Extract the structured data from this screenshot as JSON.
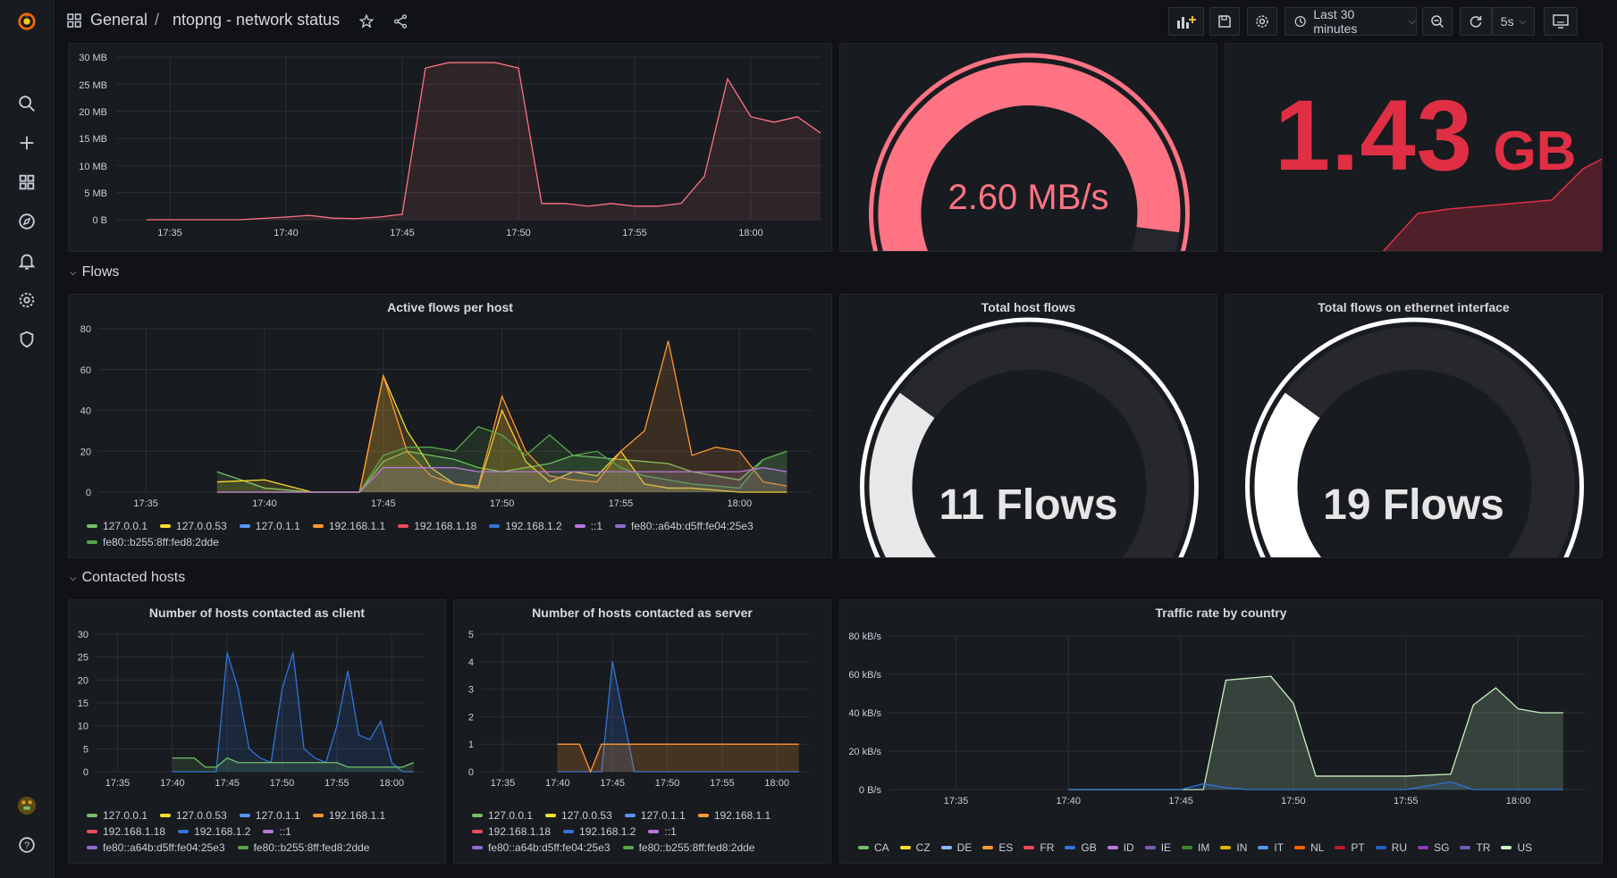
{
  "topbar": {
    "breadcrumb_folder": "General",
    "breadcrumb_sep": "/",
    "dashboard_title": "ntopng - network status",
    "time_range": "Last 30 minutes",
    "refresh_interval": "5s"
  },
  "sidebar": {
    "icons": [
      "grafana-logo-icon",
      "search-icon",
      "plus-icon",
      "dashboards-icon",
      "explore-icon",
      "alerting-icon",
      "settings-icon",
      "shield-icon",
      "user-avatar",
      "help-icon"
    ]
  },
  "panels": {
    "traffic_graph": {
      "y_ticks": [
        "30 MB",
        "25 MB",
        "20 MB",
        "15 MB",
        "10 MB",
        "5 MB",
        "0 B"
      ],
      "x_ticks": [
        "17:35",
        "17:40",
        "17:45",
        "17:50",
        "17:55",
        "18:00"
      ]
    },
    "traffic_gauge": {
      "value": "2.60 MB/s",
      "fraction": 0.86,
      "color": "#ff7383"
    },
    "total_traffic": {
      "value": "1.43",
      "unit": "GB",
      "color": "#e02f44"
    },
    "total_host_flows": {
      "title": "Total host flows",
      "value": "11 Flows",
      "fraction": 0.3
    },
    "total_eth_flows": {
      "title": "Total flows on ethernet interface",
      "value": "19 Flows",
      "fraction": 0.3
    }
  },
  "rows": {
    "flows": "Flows",
    "contacted": "Contacted hosts"
  },
  "legends": {
    "hosts": [
      {
        "name": "127.0.0.1",
        "color": "#73bf69"
      },
      {
        "name": "127.0.0.53",
        "color": "#fade2a"
      },
      {
        "name": "127.0.1.1",
        "color": "#5794f2"
      },
      {
        "name": "192.168.1.1",
        "color": "#ff9830"
      },
      {
        "name": "192.168.1.18",
        "color": "#f2495c"
      },
      {
        "name": "192.168.1.2",
        "color": "#3274d9"
      },
      {
        "name": "::1",
        "color": "#b877d9"
      },
      {
        "name": "fe80::a64b:d5ff:fe04:25e3",
        "color": "#8f6bd1"
      },
      {
        "name": "fe80::b255:8ff:fed8:2dde",
        "color": "#56a64b"
      }
    ],
    "countries": [
      {
        "name": "CA",
        "color": "#73bf69"
      },
      {
        "name": "CZ",
        "color": "#fade2a"
      },
      {
        "name": "DE",
        "color": "#8ab8ff"
      },
      {
        "name": "ES",
        "color": "#ff9830"
      },
      {
        "name": "FR",
        "color": "#f2495c"
      },
      {
        "name": "GB",
        "color": "#3274d9"
      },
      {
        "name": "ID",
        "color": "#b877d9"
      },
      {
        "name": "IE",
        "color": "#7d5cb0"
      },
      {
        "name": "IM",
        "color": "#37872d"
      },
      {
        "name": "IN",
        "color": "#e0b400"
      },
      {
        "name": "IT",
        "color": "#5794f2"
      },
      {
        "name": "NL",
        "color": "#fa6400"
      },
      {
        "name": "PT",
        "color": "#c4162a"
      },
      {
        "name": "RU",
        "color": "#1f60c4"
      },
      {
        "name": "SG",
        "color": "#8f3bb8"
      },
      {
        "name": "TR",
        "color": "#6f5bb0"
      },
      {
        "name": "US",
        "color": "#c8f2c2"
      }
    ]
  },
  "chart_data": [
    {
      "type": "area",
      "title": "",
      "x": [
        "17:34",
        "17:36",
        "17:38",
        "17:40",
        "17:41",
        "17:42",
        "17:43",
        "17:44",
        "17:45",
        "17:46",
        "17:47",
        "17:48",
        "17:49",
        "17:50",
        "17:51",
        "17:52",
        "17:53",
        "17:54",
        "17:55",
        "17:56",
        "17:57",
        "17:58",
        "17:59",
        "18:00",
        "18:01",
        "18:02",
        "18:03"
      ],
      "series": [
        {
          "values": [
            0,
            0,
            0,
            0.5,
            0.8,
            0.3,
            0.2,
            0.5,
            1,
            28,
            29,
            29,
            29,
            28,
            3,
            3,
            2.5,
            3,
            2.5,
            2.5,
            3,
            8,
            26,
            19,
            18,
            19,
            16
          ]
        }
      ],
      "ylim": [
        0,
        30
      ],
      "y_unit": "MB"
    },
    {
      "type": "line",
      "title": "Active flows per host",
      "x": [
        "17:38",
        "17:40",
        "17:42",
        "17:44",
        "17:45",
        "17:46",
        "17:47",
        "17:48",
        "17:49",
        "17:50",
        "17:51",
        "17:52",
        "17:53",
        "17:54",
        "17:55",
        "17:56",
        "17:57",
        "17:58",
        "17:59",
        "18:00",
        "18:01",
        "18:02"
      ],
      "series": [
        {
          "name": "127.0.0.1",
          "values": [
            10,
            2,
            0,
            0,
            15,
            20,
            18,
            16,
            12,
            10,
            12,
            14,
            18,
            17,
            16,
            15,
            14,
            10,
            8,
            6,
            16,
            20
          ]
        },
        {
          "name": "127.0.0.53",
          "values": [
            5,
            6,
            0,
            0,
            57,
            30,
            12,
            4,
            2,
            40,
            15,
            5,
            10,
            8,
            20,
            4,
            2,
            2,
            1,
            0,
            0,
            0
          ]
        },
        {
          "name": "192.168.1.1",
          "values": [
            0,
            0,
            0,
            0,
            57,
            20,
            8,
            4,
            3,
            47,
            20,
            8,
            6,
            5,
            20,
            30,
            74,
            18,
            22,
            20,
            5,
            3
          ]
        },
        {
          "name": "fe80::b255:8ff:fed8:2dde",
          "values": [
            0,
            0,
            0,
            0,
            18,
            22,
            22,
            20,
            32,
            28,
            18,
            28,
            18,
            20,
            12,
            8,
            6,
            4,
            3,
            2,
            16,
            20
          ]
        },
        {
          "name": "::1",
          "values": [
            0,
            0,
            0,
            0,
            12,
            12,
            12,
            12,
            10,
            10,
            10,
            10,
            10,
            10,
            10,
            10,
            10,
            10,
            10,
            10,
            12,
            10
          ]
        }
      ],
      "ylim": [
        0,
        80
      ]
    },
    {
      "type": "line",
      "title": "Number of hosts contacted as client",
      "x": [
        "17:40",
        "17:42",
        "17:43",
        "17:44",
        "17:45",
        "17:46",
        "17:47",
        "17:48",
        "17:49",
        "17:50",
        "17:51",
        "17:52",
        "17:53",
        "17:54",
        "17:55",
        "17:56",
        "17:57",
        "17:58",
        "17:59",
        "18:00",
        "18:01",
        "18:02"
      ],
      "series": [
        {
          "name": "192.168.1.2",
          "values": [
            0,
            0,
            0,
            0,
            26,
            18,
            5,
            3,
            2,
            18,
            26,
            5,
            3,
            2,
            10,
            22,
            8,
            7,
            11,
            2,
            0,
            0
          ]
        },
        {
          "name": "127.0.0.1",
          "values": [
            3,
            3,
            1,
            1,
            3,
            2,
            2,
            2,
            2,
            2,
            2,
            2,
            2,
            2,
            2,
            1,
            1,
            1,
            1,
            1,
            1,
            2
          ]
        }
      ],
      "ylim": [
        0,
        30
      ]
    },
    {
      "type": "line",
      "title": "Number of hosts contacted as server",
      "x": [
        "17:40",
        "17:41",
        "17:42",
        "17:43",
        "17:44",
        "17:45",
        "17:46",
        "17:47",
        "17:48",
        "17:49",
        "17:50",
        "17:51",
        "17:52",
        "17:53",
        "17:54",
        "17:55",
        "17:56",
        "17:57",
        "17:58",
        "17:59",
        "18:00",
        "18:01",
        "18:02"
      ],
      "series": [
        {
          "name": "192.168.1.2",
          "values": [
            0,
            0,
            0,
            0,
            0,
            4,
            2,
            0,
            0,
            0,
            0,
            0,
            0,
            0,
            0,
            0,
            0,
            0,
            0,
            0,
            0,
            0,
            0
          ]
        },
        {
          "name": "192.168.1.1",
          "values": [
            1,
            1,
            1,
            0,
            1,
            1,
            1,
            1,
            1,
            1,
            1,
            1,
            1,
            1,
            1,
            1,
            1,
            1,
            1,
            1,
            1,
            1,
            1
          ]
        }
      ],
      "ylim": [
        0,
        5
      ]
    },
    {
      "type": "line",
      "title": "Traffic rate by country",
      "x": [
        "17:40",
        "17:43",
        "17:45",
        "17:46",
        "17:47",
        "17:48",
        "17:49",
        "17:50",
        "17:51",
        "17:53",
        "17:55",
        "17:57",
        "17:58",
        "17:59",
        "18:00",
        "18:01",
        "18:02"
      ],
      "series": [
        {
          "name": "US",
          "values": [
            0,
            0,
            0,
            0,
            57,
            58,
            59,
            45,
            7,
            7,
            7,
            8,
            44,
            53,
            42,
            40,
            40
          ]
        },
        {
          "name": "GB",
          "values": [
            0,
            0,
            0,
            3,
            1,
            0,
            0,
            0,
            0,
            0,
            0,
            4,
            0,
            0,
            0,
            0,
            0
          ]
        }
      ],
      "ylim": [
        0,
        80
      ],
      "y_unit": "kB/s"
    }
  ]
}
